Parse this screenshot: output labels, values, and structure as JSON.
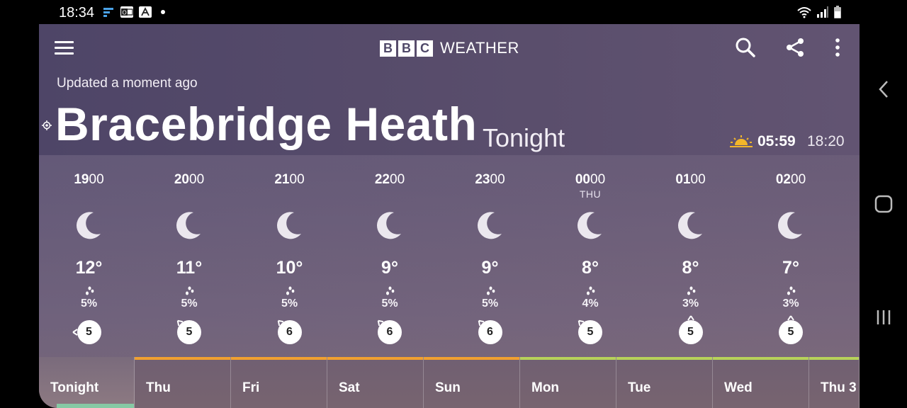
{
  "status_bar": {
    "time": "18:34",
    "notification_icons": [
      "f-icon",
      "outlook-icon",
      "news-icon"
    ]
  },
  "header": {
    "logo_letters": [
      "B",
      "B",
      "C"
    ],
    "logo_word": "WEATHER",
    "updated_text": "Updated a moment ago",
    "location": "Bracebridge Heath",
    "period": "Tonight",
    "sunrise": "05:59",
    "sunset": "18:20"
  },
  "hourly": [
    {
      "hour_bold": "19",
      "hour_rest": "00",
      "day": "",
      "temp": "12°",
      "rain": "5%",
      "wind": "5",
      "wind_dir": "W"
    },
    {
      "hour_bold": "20",
      "hour_rest": "00",
      "day": "",
      "temp": "11°",
      "rain": "5%",
      "wind": "5",
      "wind_dir": "NW"
    },
    {
      "hour_bold": "21",
      "hour_rest": "00",
      "day": "",
      "temp": "10°",
      "rain": "5%",
      "wind": "6",
      "wind_dir": "NW"
    },
    {
      "hour_bold": "22",
      "hour_rest": "00",
      "day": "",
      "temp": "9°",
      "rain": "5%",
      "wind": "6",
      "wind_dir": "NW"
    },
    {
      "hour_bold": "23",
      "hour_rest": "00",
      "day": "",
      "temp": "9°",
      "rain": "5%",
      "wind": "6",
      "wind_dir": "NW"
    },
    {
      "hour_bold": "00",
      "hour_rest": "00",
      "day": "THU",
      "temp": "8°",
      "rain": "4%",
      "wind": "5",
      "wind_dir": "NW"
    },
    {
      "hour_bold": "01",
      "hour_rest": "00",
      "day": "",
      "temp": "8°",
      "rain": "3%",
      "wind": "5",
      "wind_dir": "N"
    },
    {
      "hour_bold": "02",
      "hour_rest": "00",
      "day": "",
      "temp": "7°",
      "rain": "3%",
      "wind": "5",
      "wind_dir": "N"
    }
  ],
  "days": [
    {
      "label": "Tonight",
      "active": true,
      "color": "#86c9a4"
    },
    {
      "label": "Thu",
      "active": false,
      "color": "#f0a030"
    },
    {
      "label": "Fri",
      "active": false,
      "color": "#f0a030"
    },
    {
      "label": "Sat",
      "active": false,
      "color": "#f0a030"
    },
    {
      "label": "Sun",
      "active": false,
      "color": "#f0a030"
    },
    {
      "label": "Mon",
      "active": false,
      "color": "#b7d25a"
    },
    {
      "label": "Tue",
      "active": false,
      "color": "#b7d25a"
    },
    {
      "label": "Wed",
      "active": false,
      "color": "#b7d25a"
    },
    {
      "label": "Thu 3",
      "active": false,
      "color": "#b7d25a"
    }
  ],
  "colors": {
    "background": "#4f4868",
    "sun_icon": "#f3b62a",
    "tonight_underline": "#86c9a4"
  }
}
